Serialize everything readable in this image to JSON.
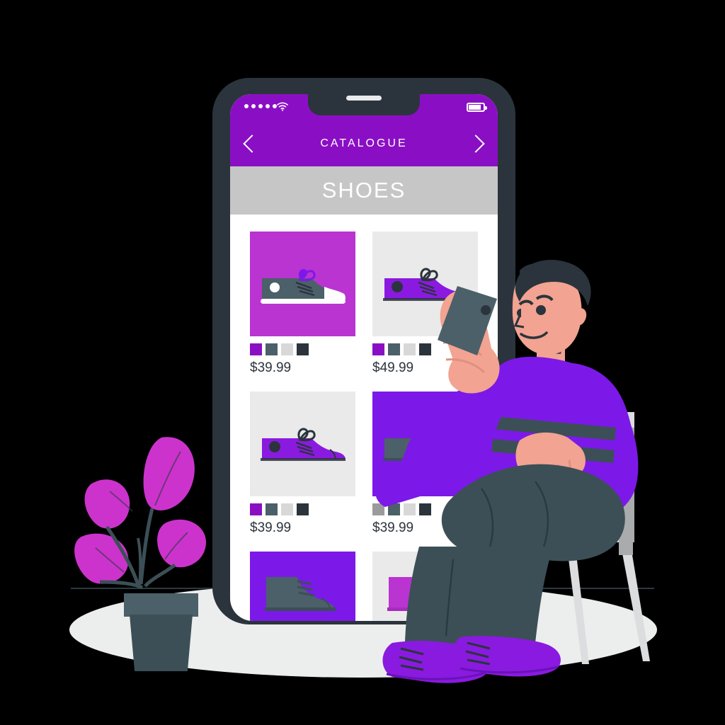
{
  "scene": {
    "title": "Online shopping catalogue illustration",
    "background_color": "#000000",
    "floor_color": "#eceded"
  },
  "phone": {
    "frame_color": "#2b343c",
    "screen_color": "#ffffff",
    "statusbar": {
      "background": "#8a0fc4",
      "signal_dots": 5,
      "wifi_icon": "wifi-icon",
      "battery_icon": "battery-icon",
      "battery_level": "65%"
    },
    "navbar": {
      "background": "#8a0fc4",
      "title": "CATALOGUE",
      "back_icon": "chevron-left-icon",
      "forward_icon": "chevron-right-icon"
    },
    "category_bar": {
      "background": "#c6c6c6",
      "label": "SHOES"
    }
  },
  "catalogue": {
    "swatch_palette": {
      "purple": "#8a0fc4",
      "slate": "#4b6068",
      "light_gray": "#d8d8d8",
      "dark_navy": "#2b343c",
      "mid_gray": "#9b9b9b"
    },
    "products": [
      {
        "id": "product-1",
        "price": "$39.99",
        "tile_background": "#b934d1",
        "shoe_style": "low-top-sneaker",
        "shoe_color": "#4b6068",
        "lace_color": "#7c19e8",
        "swatches": [
          "#8a0fc4",
          "#4b6068",
          "#d8d8d8",
          "#2b343c"
        ]
      },
      {
        "id": "product-2",
        "price": "$49.99",
        "tile_background": "#eaeaea",
        "shoe_style": "low-top-sneaker",
        "shoe_color": "#8a1ae0",
        "lace_color": "#2b343c",
        "swatches": [
          "#8a0fc4",
          "#4b6068",
          "#d8d8d8",
          "#2b343c"
        ]
      },
      {
        "id": "product-3",
        "price": "$39.99",
        "tile_background": "#eaeaea",
        "shoe_style": "low-top-sneaker",
        "shoe_color": "#8a1ae0",
        "lace_color": "#2b343c",
        "swatches": [
          "#8a0fc4",
          "#4b6068",
          "#d8d8d8",
          "#2b343c"
        ]
      },
      {
        "id": "product-4",
        "price": "$39.99",
        "tile_background": "#7c19e8",
        "shoe_style": "low-top-sneaker",
        "shoe_color": "#4b6068",
        "lace_color": "#2b343c",
        "swatches": [
          "#9b9b9b",
          "#4b6068",
          "#d8d8d8",
          "#2b343c"
        ]
      },
      {
        "id": "product-5",
        "price": "",
        "tile_background": "#7c19e8",
        "shoe_style": "high-top-boot",
        "shoe_color": "#4b6068",
        "lace_color": "#2b343c",
        "swatches": []
      },
      {
        "id": "product-6",
        "price": "",
        "tile_background": "#eaeaea",
        "shoe_style": "high-top-boot",
        "shoe_color": "#b934d1",
        "lace_color": "#2b343c",
        "swatches": []
      }
    ]
  },
  "character": {
    "name": "seated-man-with-phone",
    "skin_color": "#f2a391",
    "hair_color": "#2b343c",
    "sweater_color": "#7c19e8",
    "sweater_stripe_color": "#3c4f57",
    "jeans_color": "#3c4f57",
    "sneaker_color": "#8a1ae0",
    "held_phone_color": "#4b6068"
  },
  "chair": {
    "seat_color": "#dcdddf",
    "edge_color": "#a9abad",
    "leg_color": "#dcdddf"
  },
  "plant": {
    "leaf_color": "#cc33cc",
    "stem_color": "#3c4f57",
    "pot_rim_color": "#4b6068",
    "pot_body_color": "#3c4f57",
    "leaf_count": 4
  }
}
